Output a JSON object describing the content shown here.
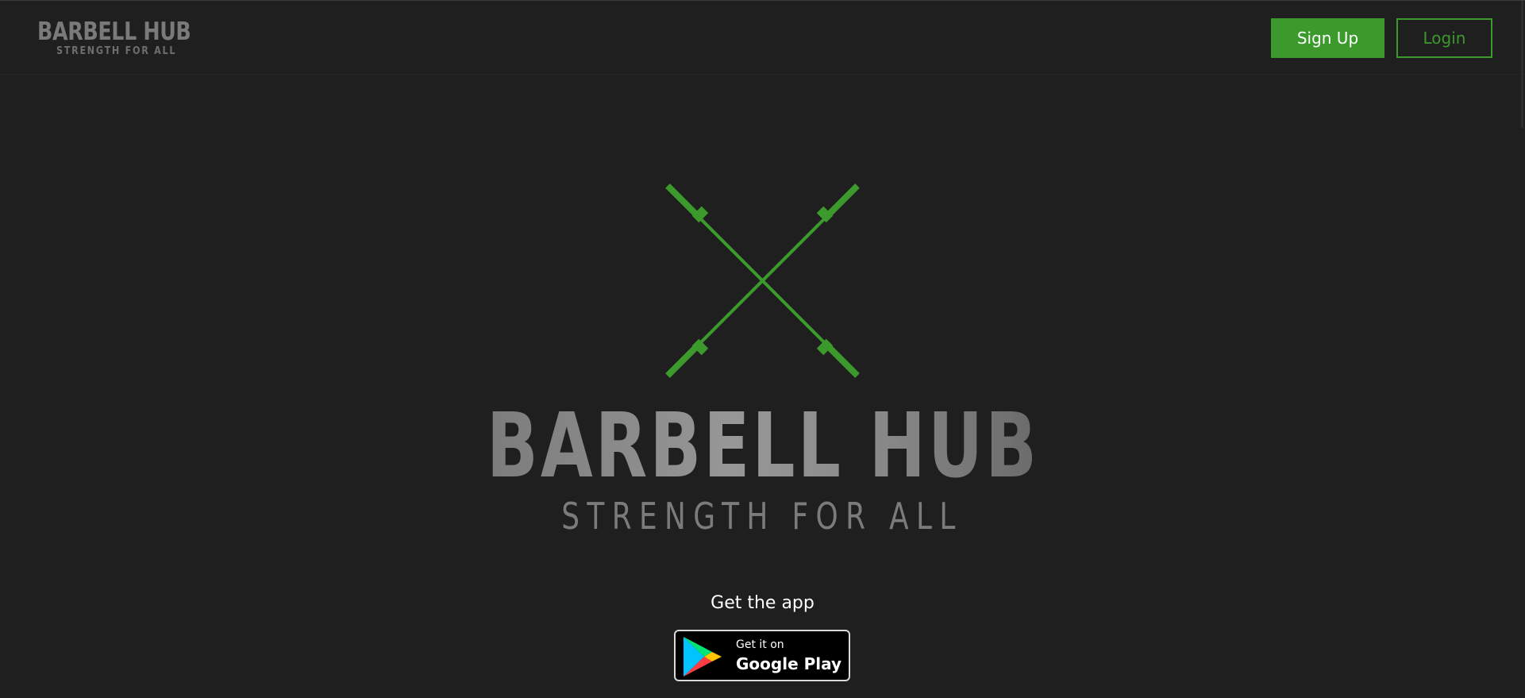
{
  "header": {
    "brand_title": "BARBELL HUB",
    "brand_subtitle": "STRENGTH FOR ALL",
    "signup_label": "Sign Up",
    "login_label": "Login"
  },
  "hero": {
    "title": "BARBELL HUB",
    "subtitle": "STRENGTH FOR ALL",
    "logo_icon": "crossed-barbells-icon"
  },
  "app": {
    "heading": "Get the app",
    "badge_small": "Get it on",
    "badge_large": "Google Play",
    "badge_icon": "google-play-icon"
  },
  "colors": {
    "background": "#1f1f1f",
    "accent": "#3c9a2c",
    "brand_gray": "#7a7a7a"
  }
}
